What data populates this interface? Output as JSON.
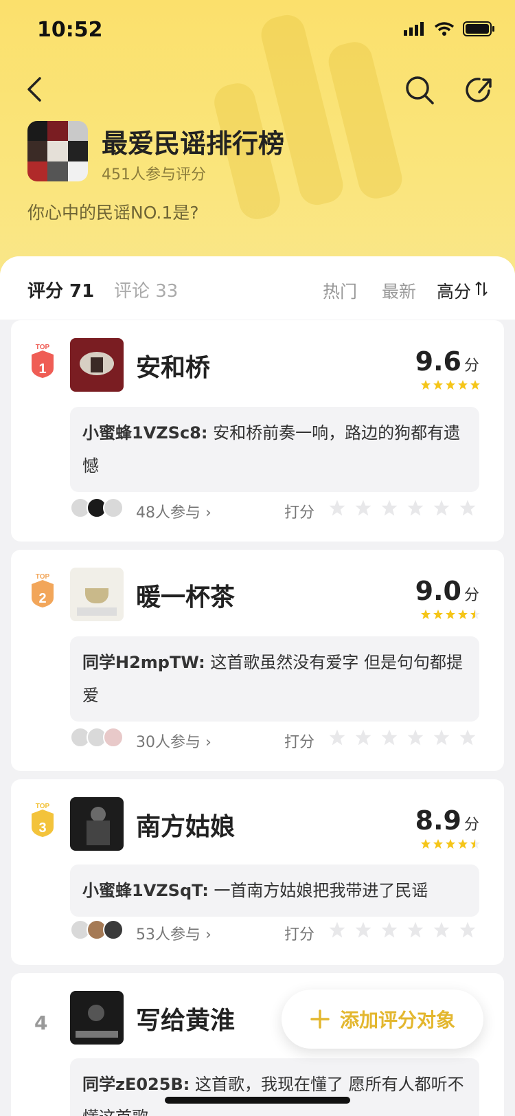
{
  "status_bar": {
    "time": "10:52"
  },
  "header": {
    "title": "最爱民谣排行榜",
    "subtitle": "451人参与评分",
    "description": "你心中的民谣NO.1是?"
  },
  "tabs": [
    {
      "label": "评分 71",
      "active": true
    },
    {
      "label": "评论 33",
      "active": false
    }
  ],
  "sort_options": [
    {
      "label": "热门",
      "active": false
    },
    {
      "label": "最新",
      "active": false
    },
    {
      "label": "高分",
      "active": true
    }
  ],
  "items": [
    {
      "rank": "1",
      "rank_badge": "TOP",
      "title": "安和桥",
      "score": "9.6",
      "score_unit": "分",
      "stars": 5,
      "comment_user": "小蜜蜂1VZSc8:",
      "comment_text": "安和桥前奏一响，路边的狗都有遗憾",
      "participants": "48人参与",
      "rate_label": "打分"
    },
    {
      "rank": "2",
      "rank_badge": "TOP",
      "title": "暖一杯茶",
      "score": "9.0",
      "score_unit": "分",
      "stars": 4.5,
      "comment_user": "同学H2mpTW:",
      "comment_text": "这首歌虽然没有爱字 但是句句都提爱",
      "participants": "30人参与",
      "rate_label": "打分"
    },
    {
      "rank": "3",
      "rank_badge": "TOP",
      "title": "南方姑娘",
      "score": "8.9",
      "score_unit": "分",
      "stars": 4.5,
      "comment_user": "小蜜蜂1VZSqT:",
      "comment_text": "一首南方姑娘把我带进了民谣",
      "participants": "53人参与",
      "rate_label": "打分"
    },
    {
      "rank": "4",
      "title": "写给黄淮",
      "comment_user": "同学zE025B:",
      "comment_text": "这首歌，我现在懂了    愿所有人都听不懂这首歌"
    }
  ],
  "fab": {
    "label": "添加评分对象"
  },
  "colors": {
    "accent": "#f5c518",
    "hero_bg": "#fae57c",
    "fab_text": "#e3b72f"
  }
}
